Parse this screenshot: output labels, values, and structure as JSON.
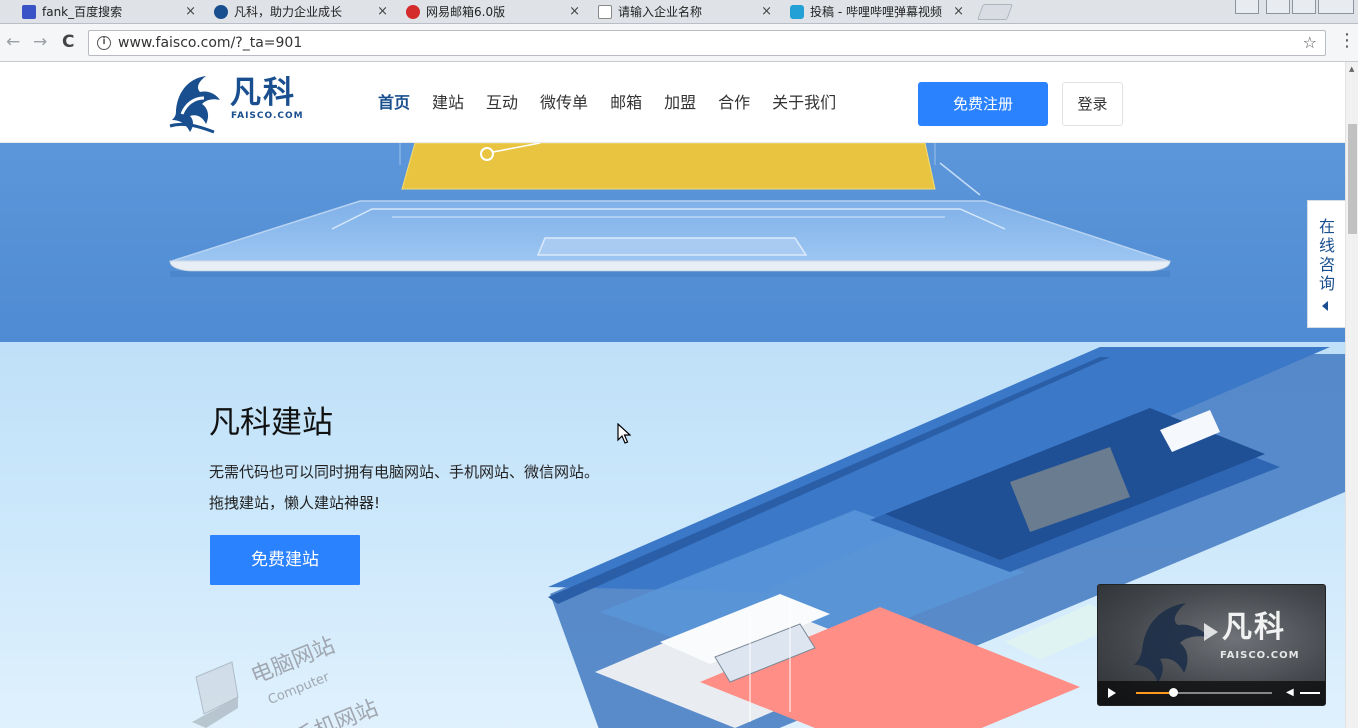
{
  "browser": {
    "tabs": [
      {
        "title": "fank_百度搜索",
        "icon": "baidu-icon",
        "color": "#3a54c8"
      },
      {
        "title": "凡科，助力企业成长",
        "icon": "faisco-icon",
        "color": "#1a4f8f",
        "active": true
      },
      {
        "title": "网易邮箱6.0版",
        "icon": "netease-icon",
        "color": "#d42b2b"
      },
      {
        "title": "请输入企业名称",
        "icon": "document-icon",
        "color": "#888888"
      },
      {
        "title": "投稿 - 哔哩哔哩弹幕视频",
        "icon": "bilibili-icon",
        "color": "#23a0d6"
      }
    ],
    "close_glyph": "×",
    "url": "www.faisco.com/?_ta=901",
    "back_glyph": "←",
    "forward_glyph": "→",
    "reload_glyph": "C",
    "star_glyph": "☆",
    "menu_glyph": "⋮",
    "info_glyph": "i"
  },
  "site": {
    "logo_text": "凡科",
    "logo_sub": "FAISCO.COM",
    "nav": [
      {
        "label": "首页",
        "active": true
      },
      {
        "label": "建站"
      },
      {
        "label": "互动"
      },
      {
        "label": "微传单"
      },
      {
        "label": "邮箱"
      },
      {
        "label": "加盟"
      },
      {
        "label": "合作"
      },
      {
        "label": "关于我们"
      }
    ],
    "register_label": "免费注册",
    "login_label": "登录"
  },
  "section": {
    "title": "凡科建站",
    "line1": "无需代码也可以同时拥有电脑网站、手机网站、微信网站。",
    "line2": "拖拽建站，懒人建站神器!",
    "button_label": "免费建站",
    "computer_label": "电脑网站",
    "computer_sub": "Computer",
    "mobile_label": "手机网站"
  },
  "consult": {
    "label": "在线咨询"
  },
  "video": {
    "logo_text": "凡科",
    "logo_sub": "FAISCO.COM",
    "progress": 0.27
  },
  "colors": {
    "accent": "#2b82ff",
    "brand": "#1a4f8f",
    "hero": "#5c96da"
  }
}
